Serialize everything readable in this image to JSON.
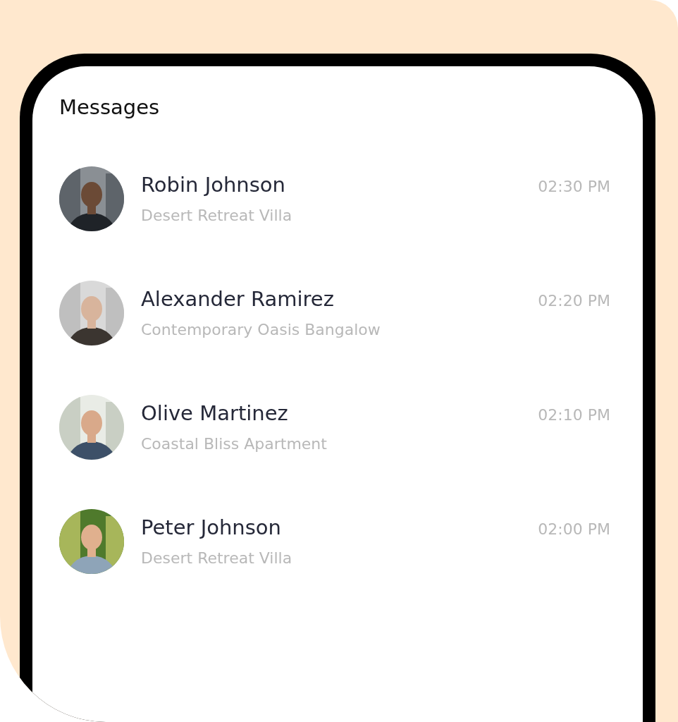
{
  "screen": {
    "title": "Messages"
  },
  "conversations": [
    {
      "name": "Robin Johnson",
      "property": "Desert Retreat Villa",
      "time": "02:30 PM"
    },
    {
      "name": "Alexander Ramirez",
      "property": "Contemporary Oasis Bangalow",
      "time": "02:20 PM"
    },
    {
      "name": "Olive Martinez",
      "property": "Coastal Bliss Apartment",
      "time": "02:10 PM"
    },
    {
      "name": "Peter Johnson",
      "property": "Desert Retreat Villa",
      "time": "02:00 PM"
    }
  ]
}
